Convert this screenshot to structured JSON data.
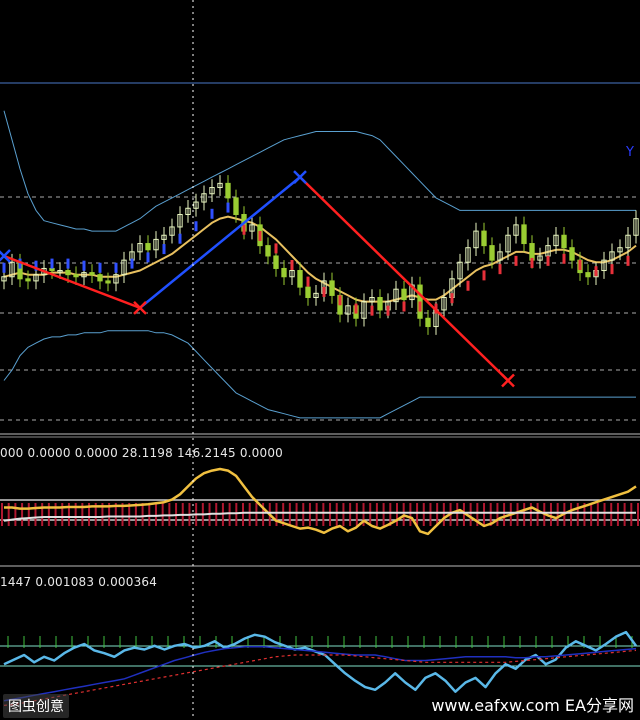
{
  "labels": {
    "top_right": "Y",
    "indicator1_readout": "000 0.0000 0.0000 28.1198 146.2145 0.0000",
    "indicator2_readout": "1447 0.001083 0.000364",
    "watermark_left": "图虫创意",
    "watermark_right": "www.eafxw.com  EA分享网"
  },
  "colors": {
    "background": "#000000",
    "bull_candle": "#e8f5c0",
    "bear_candle": "#9acd32",
    "bollinger": "#5aa0d0",
    "ma_line": "#e8c060",
    "zigzag_up": "#2050ff",
    "zigzag_down": "#ff2020",
    "marker_red": "#e8303a",
    "marker_blue": "#3050ff",
    "histogram": "#b01830",
    "osc_yellow": "#f0c040",
    "osc_white": "#e0e0e0",
    "osc2_cyan": "#5ab8e8",
    "osc2_blue": "#2030c0",
    "osc2_red_dashed": "#e03030",
    "osc2_green_ticks": "#40c040"
  },
  "chart_data": [
    {
      "type": "candlestick",
      "panel": "main",
      "title": "",
      "x": [
        1,
        2,
        3,
        4,
        5,
        6,
        7,
        8,
        9,
        10,
        11,
        12,
        13,
        14,
        15,
        16,
        17,
        18,
        19,
        20,
        21,
        22,
        23,
        24,
        25,
        26,
        27,
        28,
        29,
        30,
        31,
        32,
        33,
        34,
        35,
        36,
        37,
        38,
        39,
        40,
        41,
        42,
        43,
        44,
        45,
        46,
        47,
        48,
        49,
        50,
        51,
        52,
        53,
        54,
        55,
        56,
        57,
        58,
        59,
        60,
        61,
        62,
        63,
        64,
        65,
        66,
        67,
        68,
        69,
        70,
        71,
        72,
        73,
        74,
        75,
        76,
        77,
        78,
        79,
        80
      ],
      "close": [
        30,
        37,
        29,
        28,
        31,
        34,
        33,
        33,
        31,
        30,
        32,
        31,
        28,
        27,
        31,
        38,
        42,
        46,
        43,
        48,
        50,
        54,
        60,
        63,
        66,
        70,
        73,
        75,
        68,
        60,
        52,
        55,
        45,
        40,
        34,
        30,
        33,
        25,
        20,
        22,
        28,
        21,
        12,
        16,
        10,
        18,
        20,
        14,
        18,
        24,
        19,
        26,
        10,
        6,
        14,
        20,
        29,
        37,
        44,
        52,
        45,
        38,
        42,
        50,
        55,
        46,
        38,
        40,
        45,
        50,
        44,
        38,
        32,
        30,
        33,
        38,
        42,
        44,
        50,
        58
      ],
      "ylim": [
        -40,
        120
      ],
      "grid": false,
      "series": [
        {
          "name": "",
          "kind": "bollinger-upper",
          "values": [
            110,
            96,
            82,
            70,
            62,
            57,
            56,
            55,
            54,
            53,
            53,
            52,
            52,
            52,
            52,
            54,
            56,
            58,
            61,
            64,
            66,
            68,
            70,
            72,
            74,
            76,
            78,
            80,
            82,
            84,
            86,
            88,
            90,
            92,
            94,
            96,
            97,
            98,
            99,
            100,
            100,
            100,
            100,
            100,
            100,
            99,
            98,
            96,
            92,
            88,
            84,
            80,
            76,
            72,
            68,
            66,
            64,
            62,
            62,
            62,
            62,
            62,
            62,
            62,
            62,
            62,
            62,
            62,
            62,
            62,
            62,
            62,
            62,
            62,
            62,
            62,
            62,
            62,
            62,
            62
          ]
        },
        {
          "name": "",
          "kind": "bollinger-lower",
          "values": [
            -20,
            -15,
            -8,
            -4,
            -2,
            0,
            1,
            1,
            2,
            2,
            3,
            3,
            3,
            4,
            4,
            4,
            4,
            4,
            4,
            3,
            3,
            2,
            0,
            -2,
            -6,
            -10,
            -14,
            -18,
            -22,
            -26,
            -28,
            -30,
            -32,
            -34,
            -35,
            -36,
            -37,
            -38,
            -38,
            -38,
            -38,
            -38,
            -38,
            -38,
            -38,
            -38,
            -38,
            -38,
            -36,
            -34,
            -32,
            -30,
            -28,
            -28,
            -28,
            -28,
            -28,
            -28,
            -28,
            -28,
            -28,
            -28,
            -28,
            -28,
            -28,
            -28,
            -28,
            -28,
            -28,
            -28,
            -28,
            -28,
            -28,
            -28,
            -28,
            -28,
            -28,
            -28,
            -28,
            -28
          ]
        },
        {
          "name": "",
          "kind": "moving-average",
          "values": [
            30,
            31,
            32,
            31,
            31,
            31,
            32,
            32,
            32,
            31,
            31,
            31,
            30,
            30,
            30,
            31,
            32,
            33,
            35,
            37,
            39,
            41,
            44,
            47,
            50,
            53,
            56,
            58,
            59,
            58,
            57,
            56,
            54,
            51,
            48,
            44,
            40,
            36,
            32,
            29,
            27,
            25,
            23,
            21,
            19,
            18,
            18,
            18,
            18,
            19,
            20,
            21,
            20,
            19,
            19,
            21,
            24,
            27,
            30,
            33,
            35,
            36,
            38,
            40,
            42,
            42,
            41,
            41,
            42,
            43,
            43,
            42,
            40,
            38,
            37,
            37,
            38,
            40,
            42,
            45
          ]
        }
      ],
      "zigzag": [
        {
          "x": 1,
          "y": 40,
          "marker": "blue"
        },
        {
          "x": 18,
          "y": 15,
          "marker": "red"
        },
        {
          "x": 38,
          "y": 78,
          "marker": "blue"
        },
        {
          "x": 64,
          "y": -20,
          "marker": "red"
        }
      ]
    },
    {
      "type": "line",
      "panel": "indicator1",
      "title": "",
      "ylim": [
        -60,
        120
      ],
      "series": [
        {
          "name": "",
          "kind": "oscillator-yellow",
          "values": [
            30,
            30,
            28,
            28,
            29,
            30,
            30,
            30,
            31,
            31,
            31,
            32,
            32,
            32,
            33,
            33,
            34,
            35,
            36,
            38,
            40,
            45,
            55,
            70,
            85,
            95,
            100,
            103,
            100,
            90,
            70,
            50,
            35,
            20,
            5,
            0,
            -5,
            -10,
            -8,
            -12,
            -18,
            -10,
            -5,
            -15,
            -8,
            5,
            -5,
            -10,
            -3,
            5,
            15,
            10,
            -15,
            -20,
            -5,
            10,
            20,
            25,
            15,
            5,
            -5,
            0,
            10,
            15,
            20,
            25,
            30,
            22,
            15,
            10,
            18,
            25,
            30,
            35,
            40,
            45,
            50,
            55,
            60,
            70
          ]
        },
        {
          "name": "",
          "kind": "oscillator-white",
          "values": [
            5,
            7,
            9,
            10,
            11,
            12,
            12,
            12,
            12,
            12,
            12,
            12,
            12,
            13,
            13,
            13,
            13,
            13,
            14,
            14,
            15,
            15,
            16,
            16,
            17,
            17,
            18,
            18,
            19,
            19,
            20,
            20,
            20,
            20,
            20,
            20,
            20,
            20,
            20,
            20,
            20,
            20,
            20,
            20,
            20,
            20,
            20,
            20,
            20,
            20,
            20,
            20,
            20,
            20,
            20,
            20,
            20,
            20,
            20,
            20,
            20,
            20,
            20,
            20,
            20,
            20,
            20,
            20,
            20,
            20,
            20,
            20,
            20,
            20,
            20,
            20,
            20,
            20,
            20,
            20
          ]
        }
      ]
    },
    {
      "type": "line",
      "panel": "indicator2",
      "title": "",
      "ylim": [
        -60,
        60
      ],
      "series": [
        {
          "name": "",
          "kind": "oscillator-cyan",
          "values": [
            -10,
            -5,
            0,
            -8,
            -2,
            -6,
            2,
            8,
            12,
            5,
            2,
            -2,
            5,
            8,
            6,
            10,
            6,
            10,
            12,
            8,
            10,
            15,
            8,
            12,
            18,
            22,
            20,
            14,
            10,
            6,
            8,
            4,
            0,
            -10,
            -20,
            -28,
            -35,
            -38,
            -30,
            -20,
            -30,
            -38,
            -25,
            -20,
            -28,
            -40,
            -30,
            -25,
            -35,
            -20,
            -10,
            -15,
            -5,
            0,
            -10,
            -5,
            8,
            15,
            10,
            5,
            12,
            20,
            25,
            10
          ]
        },
        {
          "name": "",
          "kind": "signal-blue",
          "values": [
            -50,
            -48,
            -46,
            -44,
            -42,
            -40,
            -38,
            -36,
            -34,
            -32,
            -30,
            -28,
            -26,
            -22,
            -18,
            -14,
            -10,
            -6,
            -3,
            0,
            3,
            5,
            7,
            8,
            9,
            9,
            9,
            8,
            7,
            6,
            5,
            4,
            3,
            2,
            1,
            0,
            0,
            0,
            -2,
            -4,
            -6,
            -6,
            -6,
            -5,
            -4,
            -3,
            -2,
            -2,
            -2,
            -2,
            -2,
            -3,
            -3,
            -2,
            -2,
            -1,
            0,
            1,
            2,
            3,
            4,
            5,
            6,
            7
          ]
        },
        {
          "name": "",
          "kind": "signal-red-dashed",
          "values": [
            -55,
            -54,
            -52,
            -50,
            -48,
            -46,
            -44,
            -42,
            -40,
            -38,
            -36,
            -34,
            -32,
            -30,
            -28,
            -26,
            -24,
            -22,
            -20,
            -18,
            -16,
            -14,
            -12,
            -10,
            -8,
            -6,
            -4,
            -2,
            -1,
            0,
            0,
            0,
            0,
            0,
            0,
            -1,
            -2,
            -3,
            -4,
            -5,
            -6,
            -7,
            -8,
            -8,
            -8,
            -8,
            -8,
            -8,
            -8,
            -8,
            -8,
            -7,
            -6,
            -5,
            -4,
            -3,
            -2,
            -1,
            0,
            1,
            2,
            3,
            4,
            5
          ]
        }
      ]
    }
  ]
}
